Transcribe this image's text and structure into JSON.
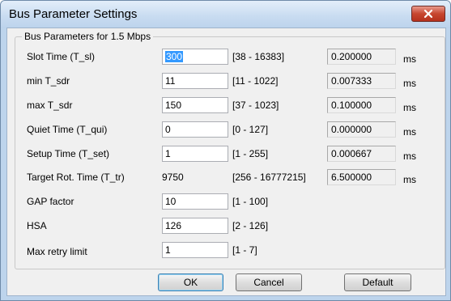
{
  "window": {
    "title": "Bus Parameter Settings"
  },
  "group": {
    "title": "Bus Parameters for 1.5 Mbps"
  },
  "rows": [
    {
      "label": "Slot Time (T_sl)",
      "value": "300",
      "range": "[38 - 16383]",
      "readout": "0.200000",
      "unit": "ms"
    },
    {
      "label": "min T_sdr",
      "value": "11",
      "range": "[11 - 1022]",
      "readout": "0.007333",
      "unit": "ms"
    },
    {
      "label": "max T_sdr",
      "value": "150",
      "range": "[37 - 1023]",
      "readout": "0.100000",
      "unit": "ms"
    },
    {
      "label": "Quiet Time (T_qui)",
      "value": "0",
      "range": "[0 - 127]",
      "readout": "0.000000",
      "unit": "ms"
    },
    {
      "label": "Setup Time (T_set)",
      "value": "1",
      "range": "[1 - 255]",
      "readout": "0.000667",
      "unit": "ms"
    },
    {
      "label": "Target Rot. Time (T_tr)",
      "value": "9750",
      "range": "[256 - 16777215]",
      "readout": "6.500000",
      "unit": "ms"
    },
    {
      "label": "GAP factor",
      "value": "10",
      "range": "[1 - 100]"
    },
    {
      "label": "HSA",
      "value": "126",
      "range": "[2 - 126]"
    },
    {
      "label": "Max retry limit",
      "value": "1",
      "range": "[1 - 7]"
    }
  ],
  "buttons": {
    "ok": "OK",
    "cancel": "Cancel",
    "default": "Default"
  },
  "icons": {
    "close": "close-icon"
  }
}
